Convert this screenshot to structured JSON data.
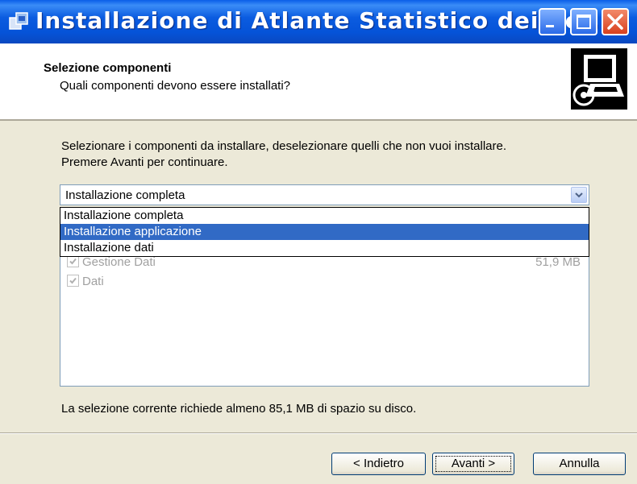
{
  "window": {
    "title": "Installazione di Atlante Statistico dei Co...",
    "icons": {
      "app": "installer-icon",
      "minimize": "minimize-icon",
      "maximize": "maximize-icon",
      "close": "close-icon"
    }
  },
  "header": {
    "title": "Selezione componenti",
    "subtitle": "Quali componenti devono essere installati?",
    "icon": "computer-disk-icon"
  },
  "body": {
    "instruction_line1": "Selezionare i componenti da installare, deselezionare quelli che non vuoi installare.",
    "instruction_line2": "Premere Avanti per continuare."
  },
  "combo": {
    "selected": "Installazione completa",
    "options": [
      "Installazione completa",
      "Installazione applicazione",
      "Installazione dati"
    ],
    "highlighted_index": 1
  },
  "components": [
    {
      "label": "Gestione Dati",
      "checked": true,
      "size": "51,9 MB"
    },
    {
      "label": "Dati",
      "checked": true,
      "size": ""
    }
  ],
  "space_text": "La selezione corrente richiede almeno 85,1 MB di spazio su disco.",
  "buttons": {
    "back": "< Indietro",
    "next": "Avanti >",
    "cancel": "Annulla"
  },
  "colors": {
    "titlebar": "#0553d8",
    "selection": "#316ac5",
    "dialog_bg": "#ece9d8"
  }
}
